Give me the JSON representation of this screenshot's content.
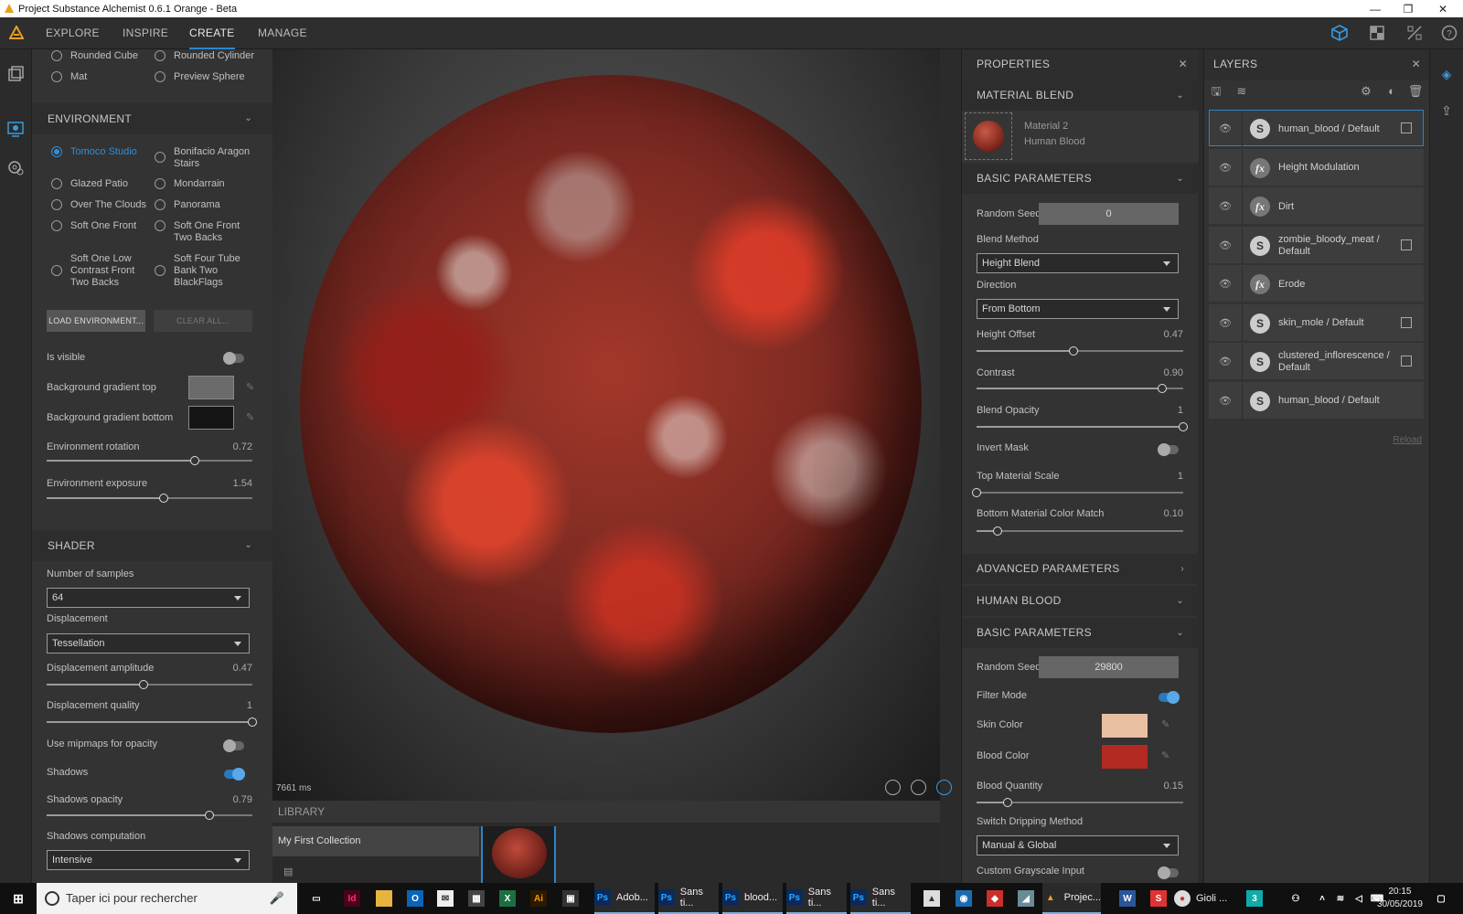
{
  "window": {
    "title": "Project Substance Alchemist 0.6.1 Orange - Beta",
    "controls": {
      "minimize": "—",
      "maximize": "❐",
      "close": "✕"
    }
  },
  "menu": {
    "tabs": [
      {
        "label": "EXPLORE"
      },
      {
        "label": "INSPIRE"
      },
      {
        "label": "CREATE",
        "active": true
      },
      {
        "label": "MANAGE"
      }
    ]
  },
  "left_panel": {
    "preview_shapes": [
      {
        "label": "Rounded Cube"
      },
      {
        "label": "Rounded Cylinder"
      },
      {
        "label": "Mat"
      },
      {
        "label": "Preview Sphere"
      }
    ],
    "environment": {
      "title": "ENVIRONMENT",
      "options": [
        {
          "label": "Tomoco Studio",
          "selected": true
        },
        {
          "label": "Bonifacio Aragon Stairs"
        },
        {
          "label": "Glazed Patio"
        },
        {
          "label": "Mondarrain"
        },
        {
          "label": "Over The Clouds"
        },
        {
          "label": "Panorama"
        },
        {
          "label": "Soft One Front"
        },
        {
          "label": "Soft One Front Two Backs"
        },
        {
          "label": "Soft One Low Contrast Front Two Backs"
        },
        {
          "label": "Soft Four Tube Bank Two BlackFlags"
        }
      ],
      "load_button": "LOAD ENVIRONMENT...",
      "clear_button": "CLEAR ALL...",
      "is_visible_label": "Is visible",
      "is_visible": false,
      "bg_top_label": "Background gradient top",
      "bg_top_color": "#6b6b6b",
      "bg_bottom_label": "Background gradient bottom",
      "bg_bottom_color": "#151515",
      "rotation_label": "Environment rotation",
      "rotation_value": "0.72",
      "rotation_fraction": 0.72,
      "exposure_label": "Environment exposure",
      "exposure_value": "1.54",
      "exposure_fraction": 0.57
    },
    "shader": {
      "title": "SHADER",
      "samples_label": "Number of samples",
      "samples_value": "64",
      "displacement_label": "Displacement",
      "displacement_value": "Tessellation",
      "amp_label": "Displacement amplitude",
      "amp_value": "0.47",
      "amp_fraction": 0.47,
      "quality_label": "Displacement quality",
      "quality_value": "1",
      "quality_fraction": 1.0,
      "mipmaps_label": "Use mipmaps for opacity",
      "mipmaps": false,
      "shadows_label": "Shadows",
      "shadows": true,
      "shadow_opacity_label": "Shadows opacity",
      "shadow_opacity_value": "0.79",
      "shadow_opacity_fraction": 0.79,
      "shadow_comp_label": "Shadows computation",
      "shadow_comp_value": "Intensive"
    }
  },
  "viewport": {
    "render_time": "7661 ms"
  },
  "library": {
    "title": "LIBRARY",
    "collection": "My First Collection"
  },
  "properties": {
    "title": "PROPERTIES",
    "material_blend": {
      "title": "MATERIAL BLEND",
      "material_line1": "Material 2",
      "material_line2": "Human Blood"
    },
    "basic": {
      "title": "BASIC PARAMETERS",
      "seed_label": "Random Seed",
      "seed_value": "0",
      "blend_method_label": "Blend Method",
      "blend_method_value": "Height Blend",
      "direction_label": "Direction",
      "direction_value": "From Bottom",
      "height_offset_label": "Height Offset",
      "height_offset_value": "0.47",
      "height_offset_fraction": 0.47,
      "contrast_label": "Contrast",
      "contrast_value": "0.90",
      "contrast_fraction": 0.9,
      "blend_opacity_label": "Blend Opacity",
      "blend_opacity_value": "1",
      "blend_opacity_fraction": 1.0,
      "invert_mask_label": "Invert Mask",
      "invert_mask": false,
      "top_scale_label": "Top Material Scale",
      "top_scale_value": "1",
      "top_scale_fraction": 0.0,
      "color_match_label": "Bottom Material Color Match",
      "color_match_value": "0.10",
      "color_match_fraction": 0.1
    },
    "advanced_title": "ADVANCED PARAMETERS",
    "human_blood_title": "HUMAN BLOOD",
    "hb_basic": {
      "title": "BASIC PARAMETERS",
      "seed_label": "Random Seed",
      "seed_value": "29800",
      "filter_label": "Filter Mode",
      "filter": true,
      "skin_label": "Skin Color",
      "skin_color": "#e9bfa2",
      "blood_label": "Blood Color",
      "blood_color": "#b22a22",
      "quantity_label": "Blood Quantity",
      "quantity_value": "0.15",
      "quantity_fraction": 0.15,
      "dripping_label": "Switch Dripping Method",
      "dripping_value": "Manual & Global",
      "custom_label": "Custom Grayscale Input",
      "custom": false
    }
  },
  "layers": {
    "title": "LAYERS",
    "items": [
      {
        "name": "human_blood / Default",
        "icon": "substance-icon",
        "selected": true,
        "copy": true
      },
      {
        "name": "Height Modulation",
        "icon": "fx-icon"
      },
      {
        "name": "Dirt",
        "icon": "fx-icon"
      },
      {
        "name": "zombie_bloody_meat / Default",
        "icon": "substance-icon",
        "copy": true
      },
      {
        "name": "Erode",
        "icon": "fx-icon"
      },
      {
        "name": "skin_mole / Default",
        "icon": "substance-icon",
        "copy": true
      },
      {
        "name": "clustered_inflorescence / Default",
        "icon": "substance-icon",
        "copy": true
      },
      {
        "name": "human_blood / Default",
        "icon": "substance-icon"
      }
    ],
    "reload": "Reload"
  },
  "taskbar": {
    "search_placeholder": "Taper ici pour rechercher",
    "apps": [
      {
        "label": "Adob...",
        "icon": "Ps",
        "color": "#0b2a5c"
      },
      {
        "label": "Sans ti...",
        "icon": "Ps",
        "color": "#0b2a5c"
      },
      {
        "label": "blood...",
        "icon": "Ps",
        "color": "#0b2a5c"
      },
      {
        "label": "Sans ti...",
        "icon": "Ps",
        "color": "#0b2a5c"
      },
      {
        "label": "Sans ti...",
        "icon": "Ps",
        "color": "#0b2a5c"
      }
    ],
    "projec_label": "Projec...",
    "gioli_label": "Gioli ...",
    "time": "20:15",
    "date": "30/05/2019"
  },
  "colors": {
    "accent": "#2a86c9"
  }
}
